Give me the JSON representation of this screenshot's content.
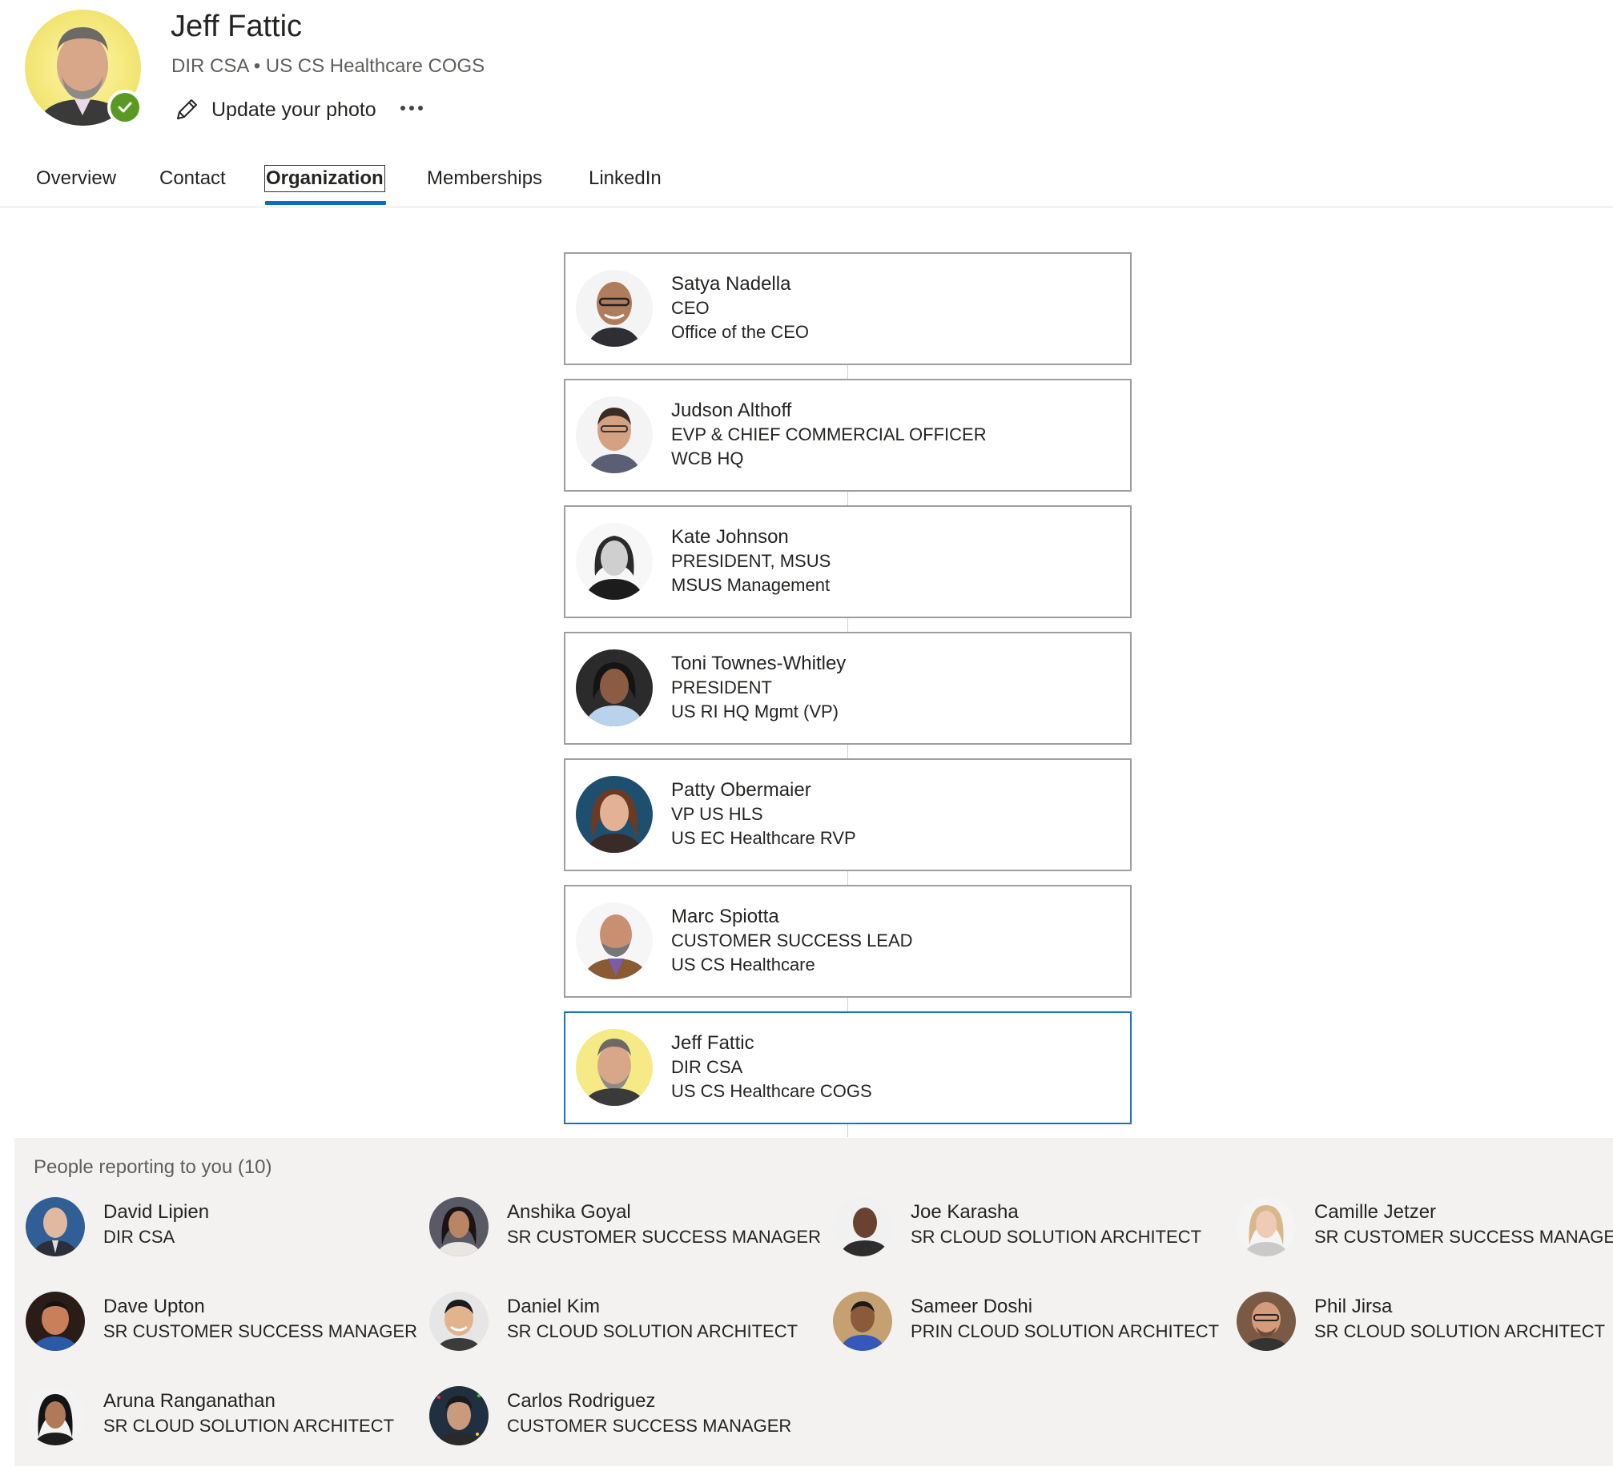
{
  "profile": {
    "name": "Jeff Fattic",
    "subtitle": "DIR CSA • US CS Healthcare COGS",
    "update_photo_label": "Update your photo",
    "presence": "available",
    "icons": {
      "edit": "pencil-icon",
      "more": "more-icon",
      "presence": "checkmark-icon"
    }
  },
  "tabs": [
    {
      "label": "Overview"
    },
    {
      "label": "Contact"
    },
    {
      "label": "Organization",
      "active": true
    },
    {
      "label": "Memberships"
    },
    {
      "label": "LinkedIn"
    }
  ],
  "chain": [
    {
      "name": "Satya Nadella",
      "title": "CEO",
      "department": "Office of the CEO"
    },
    {
      "name": "Judson Althoff",
      "title": "EVP & CHIEF COMMERCIAL OFFICER",
      "department": "WCB HQ"
    },
    {
      "name": "Kate Johnson",
      "title": "PRESIDENT, MSUS",
      "department": "MSUS Management"
    },
    {
      "name": "Toni Townes-Whitley",
      "title": "PRESIDENT",
      "department": "US RI HQ Mgmt (VP)"
    },
    {
      "name": "Patty Obermaier",
      "title": "VP US HLS",
      "department": "US EC Healthcare RVP"
    },
    {
      "name": "Marc Spiotta",
      "title": "CUSTOMER SUCCESS LEAD",
      "department": "US CS Healthcare"
    },
    {
      "name": "Jeff Fattic",
      "title": "DIR CSA",
      "department": "US CS Healthcare COGS",
      "current": true
    }
  ],
  "reports": {
    "title": "People reporting to you (10)",
    "people": [
      {
        "name": "David Lipien",
        "title": "DIR CSA"
      },
      {
        "name": "Anshika Goyal",
        "title": "SR CUSTOMER SUCCESS MANAGER"
      },
      {
        "name": "Joe Karasha",
        "title": "SR CLOUD SOLUTION ARCHITECT"
      },
      {
        "name": "Camille Jetzer",
        "title": "SR CUSTOMER SUCCESS MANAGER"
      },
      {
        "name": "Dave Upton",
        "title": "SR CUSTOMER SUCCESS MANAGER"
      },
      {
        "name": "Daniel Kim",
        "title": "SR CLOUD SOLUTION ARCHITECT"
      },
      {
        "name": "Sameer Doshi",
        "title": "PRIN CLOUD SOLUTION ARCHITECT"
      },
      {
        "name": "Phil Jirsa",
        "title": "SR CLOUD SOLUTION ARCHITECT"
      },
      {
        "name": "Aruna Ranganathan",
        "title": "SR CLOUD SOLUTION ARCHITECT"
      },
      {
        "name": "Carlos Rodriguez",
        "title": "CUSTOMER SUCCESS MANAGER"
      }
    ]
  },
  "colors": {
    "accent": "#0f6cbd",
    "presence_available": "#5b9a22",
    "panel_background": "#f3f2f1",
    "card_border": "#a19f9d"
  }
}
